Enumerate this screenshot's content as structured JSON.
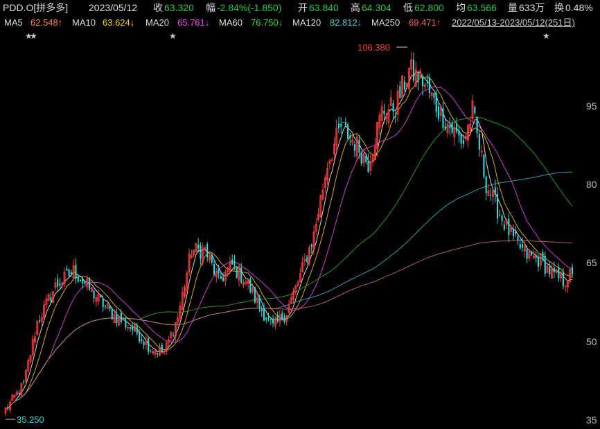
{
  "quote": {
    "symbol": "PDD.O[拼多多]",
    "date": "2023/05/12",
    "close_label": "收",
    "close": "63.320",
    "change_label": "幅",
    "change": "-2.84%(-1.850)",
    "open_label": "开",
    "open": "63.840",
    "high_label": "高",
    "high": "64.304",
    "low_label": "低",
    "low": "62.800",
    "avg_label": "均",
    "avg": "63.566",
    "volume_label": "量",
    "volume": "633万",
    "turnover_label": "换",
    "turnover": "0.48%"
  },
  "ma": {
    "ma5_label": "MA5",
    "ma5": "62.548↑",
    "ma10_label": "MA10",
    "ma10": "63.624↓",
    "ma20_label": "MA20",
    "ma20": "65.761↓",
    "ma60_label": "MA60",
    "ma60": "76.750↓",
    "ma120_label": "MA120",
    "ma120": "82.812↓",
    "ma250_label": "MA250",
    "ma250": "69.471↑",
    "range": "2022/05/13-2023/05/12(251日)"
  },
  "colors": {
    "up": "#ff3b3b",
    "down": "#22e0e0",
    "ma5": "#ffffff",
    "ma10": "#ffd000",
    "ma20": "#ff40ff",
    "ma60": "#2db52d",
    "ma120": "#3ab8c8",
    "ma250": "#e06868"
  },
  "chart_data": {
    "type": "candlestick",
    "ylim": [
      35,
      107
    ],
    "yticks": [
      "95",
      "80",
      "65",
      "50",
      "35"
    ],
    "annotations": {
      "high": "106.380",
      "low": "35.250"
    },
    "event_markers": [
      "★",
      "★",
      "★",
      "★"
    ],
    "anchors": [
      [
        0,
        37
      ],
      [
        8,
        42
      ],
      [
        14,
        54
      ],
      [
        22,
        61
      ],
      [
        30,
        64
      ],
      [
        38,
        60
      ],
      [
        46,
        56
      ],
      [
        52,
        54
      ],
      [
        58,
        52
      ],
      [
        64,
        49
      ],
      [
        70,
        48
      ],
      [
        76,
        55
      ],
      [
        82,
        68
      ],
      [
        88,
        68
      ],
      [
        94,
        62
      ],
      [
        100,
        65
      ],
      [
        106,
        62
      ],
      [
        112,
        57
      ],
      [
        118,
        53
      ],
      [
        124,
        56
      ],
      [
        130,
        63
      ],
      [
        136,
        71
      ],
      [
        142,
        85
      ],
      [
        148,
        92
      ],
      [
        154,
        89
      ],
      [
        160,
        85
      ],
      [
        166,
        95
      ],
      [
        172,
        96
      ],
      [
        178,
        103
      ],
      [
        184,
        101
      ],
      [
        190,
        96
      ],
      [
        196,
        92
      ],
      [
        202,
        89
      ],
      [
        206,
        95
      ],
      [
        212,
        81
      ],
      [
        218,
        75
      ],
      [
        224,
        70
      ],
      [
        230,
        67
      ],
      [
        236,
        66
      ],
      [
        242,
        63
      ],
      [
        246,
        62
      ],
      [
        250,
        63.3
      ]
    ],
    "last_close": 63.32
  }
}
